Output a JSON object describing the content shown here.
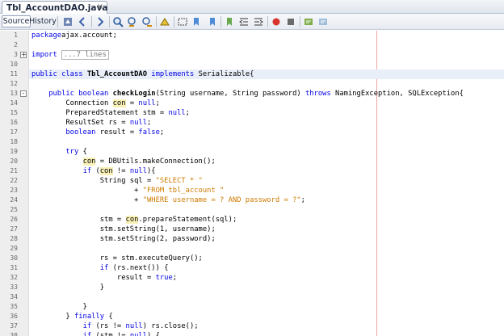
{
  "tab": {
    "title": "Tbl_AccountDAO.java",
    "close": "×"
  },
  "toolbar": {
    "source_label": "Source",
    "history_label": "History",
    "icons": [
      "last-edit-icon",
      "back-icon",
      "forward-icon",
      "find-selection-icon",
      "find-previous-icon",
      "find-next-icon",
      "toggle-highlight-icon",
      "toggle-rect-select-icon",
      "prev-bookmark-icon",
      "next-bookmark-icon",
      "toggle-bookmark-icon",
      "shift-left-icon",
      "shift-right-icon",
      "start-macro-icon",
      "stop-macro-icon",
      "comment-icon",
      "uncomment-icon"
    ]
  },
  "lines": [
    {
      "n": "1",
      "t": [
        [
          "kw",
          "package"
        ],
        [
          "",
          "ajax.account;"
        ]
      ]
    },
    {
      "n": "2",
      "t": []
    },
    {
      "n": "3",
      "fold": "+",
      "t": [
        [
          "kw",
          "import"
        ],
        [
          "",
          ""
        ],
        [
          "collapsed",
          "...7 lines"
        ]
      ]
    },
    {
      "n": "10",
      "t": []
    },
    {
      "n": "11",
      "hl": true,
      "t": [
        [
          "kw",
          "public class"
        ],
        [
          "bld",
          " Tbl_AccountDAO"
        ],
        [
          "kw",
          " implements"
        ],
        [
          "",
          " Serializable{"
        ]
      ]
    },
    {
      "n": "12",
      "t": []
    },
    {
      "n": "13",
      "fold": "-",
      "t": [
        [
          "",
          "    "
        ],
        [
          "kw",
          "public boolean"
        ],
        [
          "bld",
          " checkLogin"
        ],
        [
          "",
          "(String username, String password) "
        ],
        [
          "kw",
          "throws"
        ],
        [
          "",
          " NamingException, SQLException{"
        ]
      ]
    },
    {
      "n": "14",
      "t": [
        [
          "",
          "        Connection "
        ],
        [
          "mark",
          "con"
        ],
        [
          "",
          " = "
        ],
        [
          "kw",
          "null"
        ],
        [
          "",
          ";"
        ]
      ]
    },
    {
      "n": "15",
      "t": [
        [
          "",
          "        PreparedStatement stm = "
        ],
        [
          "kw",
          "null"
        ],
        [
          "",
          ";"
        ]
      ]
    },
    {
      "n": "16",
      "t": [
        [
          "",
          "        ResultSet rs = "
        ],
        [
          "kw",
          "null"
        ],
        [
          "",
          ";"
        ]
      ]
    },
    {
      "n": "17",
      "t": [
        [
          "",
          "        "
        ],
        [
          "kw",
          "boolean"
        ],
        [
          "",
          " result = "
        ],
        [
          "kw",
          "false"
        ],
        [
          "",
          ";"
        ]
      ]
    },
    {
      "n": "18",
      "t": []
    },
    {
      "n": "19",
      "t": [
        [
          "",
          "        "
        ],
        [
          "kw",
          "try"
        ],
        [
          "",
          " {"
        ]
      ]
    },
    {
      "n": "20",
      "t": [
        [
          "",
          "            "
        ],
        [
          "mark",
          "con"
        ],
        [
          "",
          " = DBUtils.makeConnection();"
        ]
      ]
    },
    {
      "n": "21",
      "t": [
        [
          "",
          "            "
        ],
        [
          "kw",
          "if"
        ],
        [
          "",
          " ("
        ],
        [
          "mark",
          "con"
        ],
        [
          "",
          " != "
        ],
        [
          "kw",
          "null"
        ],
        [
          "",
          "){"
        ]
      ]
    },
    {
      "n": "22",
      "t": [
        [
          "",
          "                String sql = "
        ],
        [
          "str",
          "\"SELECT * \""
        ]
      ]
    },
    {
      "n": "23",
      "t": [
        [
          "",
          "                        + "
        ],
        [
          "str",
          "\"FROM tbl_account \""
        ]
      ]
    },
    {
      "n": "24",
      "t": [
        [
          "",
          "                        + "
        ],
        [
          "str",
          "\"WHERE username = ? AND password = ?\""
        ],
        [
          "",
          ";"
        ]
      ]
    },
    {
      "n": "25",
      "t": []
    },
    {
      "n": "26",
      "t": [
        [
          "",
          "                stm = "
        ],
        [
          "mark",
          "con"
        ],
        [
          "",
          ".prepareStatement(sql);"
        ]
      ]
    },
    {
      "n": "27",
      "t": [
        [
          "",
          "                stm.setString(1, username);"
        ]
      ]
    },
    {
      "n": "28",
      "t": [
        [
          "",
          "                stm.setString(2, password);"
        ]
      ]
    },
    {
      "n": "29",
      "t": []
    },
    {
      "n": "30",
      "t": [
        [
          "",
          "                rs = stm.executeQuery();"
        ]
      ]
    },
    {
      "n": "31",
      "t": [
        [
          "",
          "                "
        ],
        [
          "kw",
          "if"
        ],
        [
          "",
          " (rs.next()) {"
        ]
      ]
    },
    {
      "n": "32",
      "t": [
        [
          "",
          "                    result = "
        ],
        [
          "kw",
          "true"
        ],
        [
          "",
          ";"
        ]
      ]
    },
    {
      "n": "33",
      "t": [
        [
          "",
          "                }"
        ]
      ]
    },
    {
      "n": "34",
      "t": []
    },
    {
      "n": "35",
      "t": [
        [
          "",
          "            }"
        ]
      ]
    },
    {
      "n": "36",
      "t": [
        [
          "",
          "        } "
        ],
        [
          "kw",
          "finally"
        ],
        [
          "",
          " {"
        ]
      ]
    },
    {
      "n": "37",
      "t": [
        [
          "",
          "            "
        ],
        [
          "kw",
          "if"
        ],
        [
          "",
          " (rs != "
        ],
        [
          "kw",
          "null"
        ],
        [
          "",
          ") rs.close();"
        ]
      ]
    },
    {
      "n": "38",
      "t": [
        [
          "",
          "            "
        ],
        [
          "kw",
          "if"
        ],
        [
          "",
          " (stm != "
        ],
        [
          "kw",
          "null"
        ],
        [
          "",
          ") {"
        ]
      ]
    }
  ]
}
